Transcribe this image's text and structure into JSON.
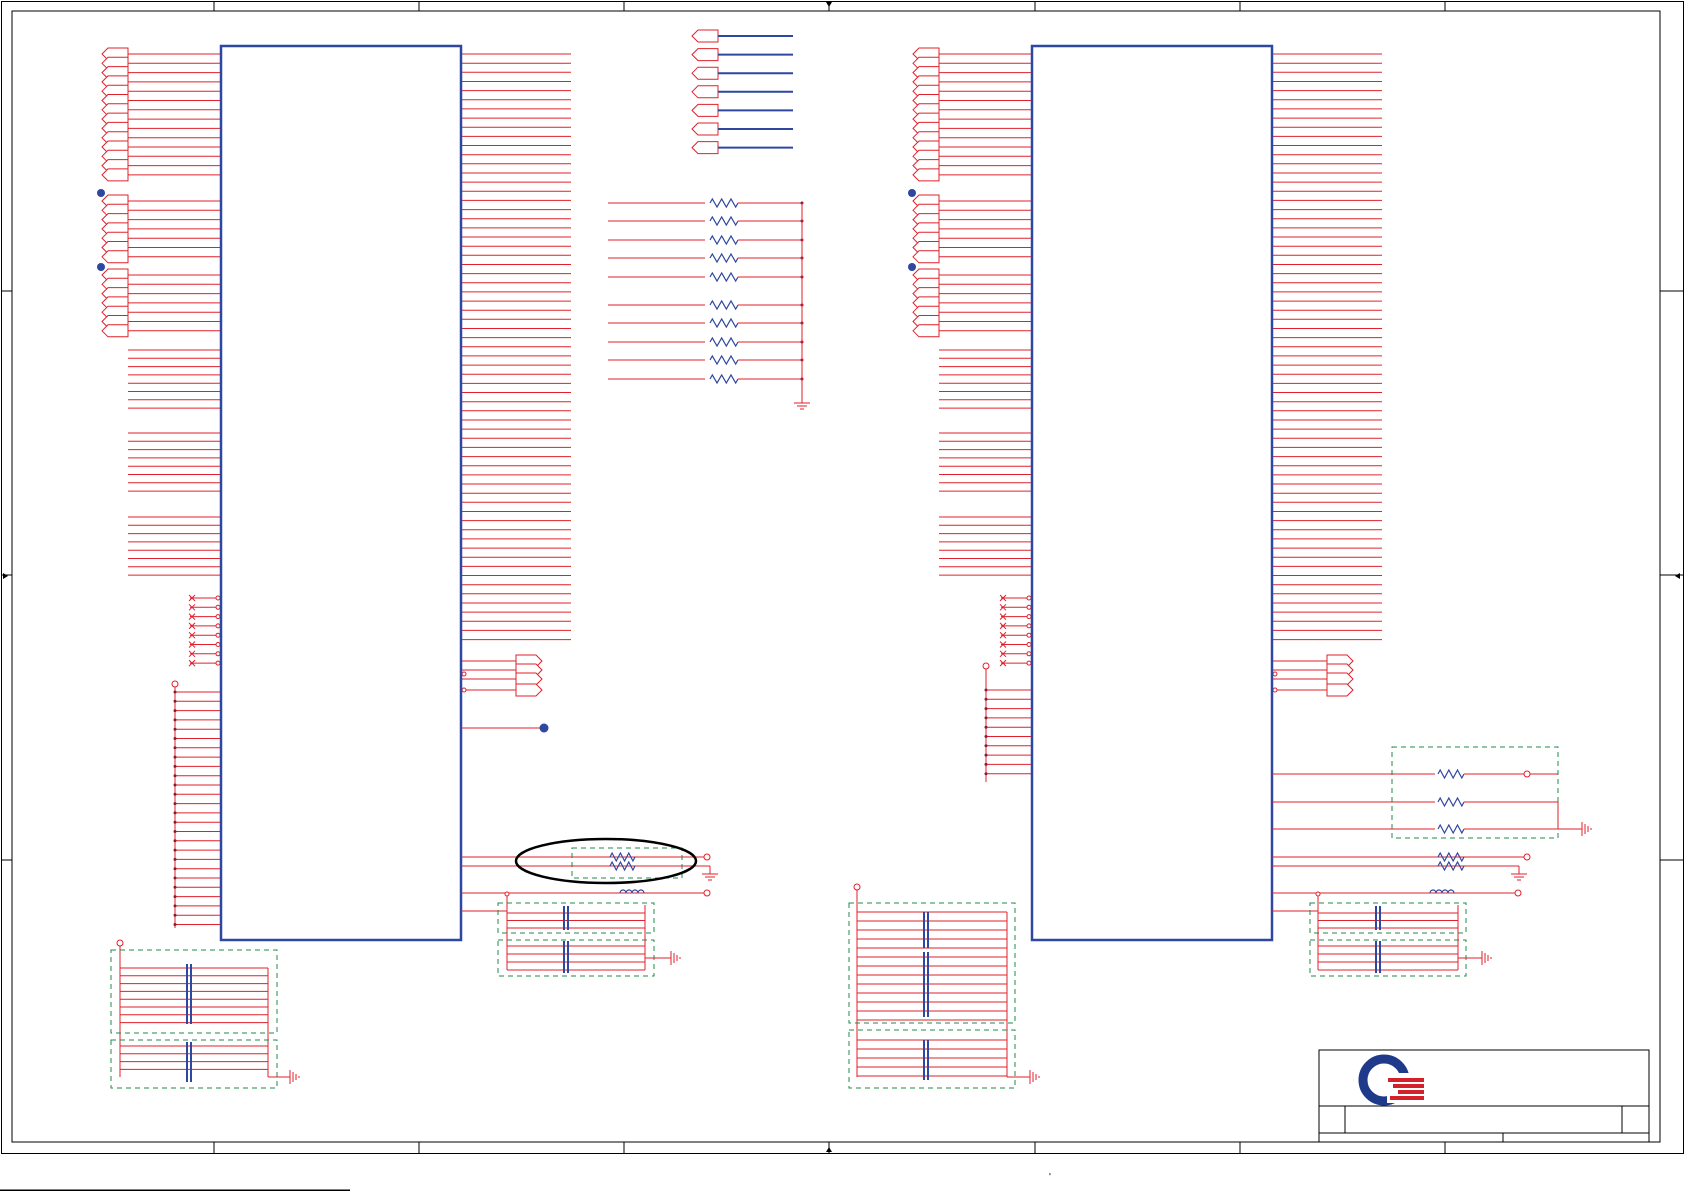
{
  "colors": {
    "background": "#ffffff",
    "frame": "#000000",
    "component_outline": "#2e47a0",
    "wire": "#e0202a",
    "wire_dark": "#8b1a3a",
    "junction": "#2e47a0",
    "group_box": "#1f8a4a",
    "highlight_ellipse": "#000000",
    "logo_blue": "#1f3a8a",
    "logo_red": "#d4202a"
  },
  "icons": {
    "logo": "company-logo-icon",
    "ground": "ground-symbol-icon",
    "resistor": "resistor-symbol-icon",
    "capacitor": "capacitor-symbol-icon",
    "inductor": "inductor-symbol-icon",
    "connector": "off-page-connector-icon",
    "no_connect": "no-connect-cross-icon"
  },
  "footer": {
    "mark": "'"
  }
}
